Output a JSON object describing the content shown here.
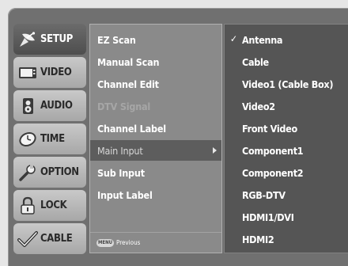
{
  "categories": [
    {
      "label": "SETUP",
      "icon": "satellite-dish-icon",
      "active": true
    },
    {
      "label": "VIDEO",
      "icon": "tv-screen-icon",
      "active": false
    },
    {
      "label": "AUDIO",
      "icon": "speaker-icon",
      "active": false
    },
    {
      "label": "TIME",
      "icon": "clock-icon",
      "active": false
    },
    {
      "label": "OPTION",
      "icon": "wrench-icon",
      "active": false
    },
    {
      "label": "LOCK",
      "icon": "padlock-icon",
      "active": false
    },
    {
      "label": "CABLE",
      "icon": "cable-check-icon",
      "active": false
    }
  ],
  "submenu": {
    "items": [
      {
        "label": "EZ Scan",
        "state": "normal"
      },
      {
        "label": "Manual Scan",
        "state": "normal"
      },
      {
        "label": "Channel Edit",
        "state": "normal"
      },
      {
        "label": "DTV Signal",
        "state": "disabled"
      },
      {
        "label": "Channel Label",
        "state": "normal"
      },
      {
        "label": "Main Input",
        "state": "selected"
      },
      {
        "label": "Sub Input",
        "state": "normal"
      },
      {
        "label": "Input Label",
        "state": "normal"
      }
    ],
    "footer": {
      "key_label": "MENU",
      "text": "Previous"
    }
  },
  "options": {
    "checked_index": 0,
    "check_glyph": "✓",
    "items": [
      "Antenna",
      "Cable",
      "Video1 (Cable Box)",
      "Video2",
      "Front Video",
      "Component1",
      "Component2",
      "RGB-DTV",
      "HDMI1/DVI",
      "HDMI2"
    ]
  }
}
